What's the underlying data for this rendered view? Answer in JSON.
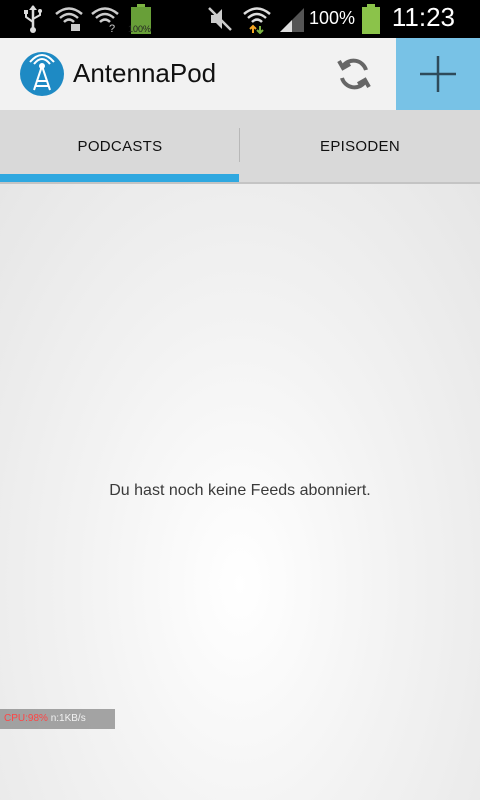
{
  "status_bar": {
    "battery_percent": "100%",
    "small_battery_label": "100%",
    "clock": "11:23",
    "icons": [
      "usb-icon",
      "wifi-lock-icon",
      "wifi-question-icon",
      "battery-small-icon",
      "mute-icon",
      "wifi-data-icon",
      "signal-icon",
      "battery-icon"
    ]
  },
  "action_bar": {
    "title": "AntennaPod",
    "refresh_icon": "refresh-icon",
    "add_icon": "add-icon",
    "accent": "#78c2e6"
  },
  "tabs": [
    {
      "label": "PODCASTS",
      "selected": true
    },
    {
      "label": "EPISODEN",
      "selected": false
    }
  ],
  "tab_indicator_color": "#2fa8e0",
  "content": {
    "empty_message": "Du hast noch keine Feeds abonniert."
  },
  "overlay": {
    "cpu": "CPU:98%",
    "net": "n:1KB/s"
  }
}
